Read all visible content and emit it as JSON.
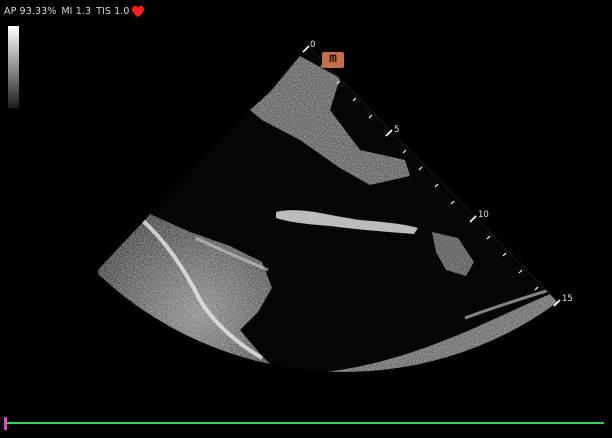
{
  "status": {
    "ap": "AP 93.33%",
    "mi": "MI 1.3",
    "tis": "TIS 1.0",
    "ecg_icon": "heart-icon"
  },
  "mode_badge": "m",
  "depth_scale": {
    "labels": [
      "0",
      "5",
      "10",
      "15"
    ],
    "unit_ticks_between_labels": 4
  },
  "timeline": {
    "position_fraction": 0.0
  },
  "colors": {
    "background": "#000000",
    "text": "#e6e6e6",
    "heart": "#ff2020",
    "badge": "#c2704a",
    "timeline": "#2ecf5a",
    "timeline_marker": "#e046c8"
  }
}
